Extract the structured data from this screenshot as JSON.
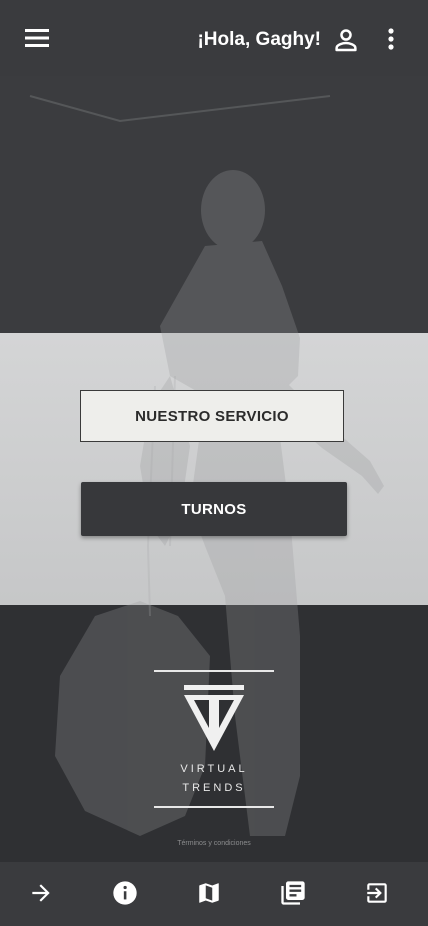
{
  "header": {
    "greeting": "¡Hola, Gaghy!",
    "menu_icon": "menu-icon",
    "user_icon": "person-icon",
    "more_icon": "more-vert-icon"
  },
  "main": {
    "service_button": "NUESTRO SERVICIO",
    "turnos_button": "TURNOS"
  },
  "brand": {
    "line1": "VIRTUAL",
    "line2": "TRENDS"
  },
  "footer": {
    "terms": "Términos y condiciones"
  },
  "bottom_nav": [
    {
      "icon": "arrow-forward-icon"
    },
    {
      "icon": "info-icon"
    },
    {
      "icon": "map-icon"
    },
    {
      "icon": "news-icon"
    },
    {
      "icon": "exit-icon"
    }
  ],
  "colors": {
    "bar": "#3a3b3e",
    "light_band": "#cdcecf",
    "accent_dark": "#37383b"
  }
}
